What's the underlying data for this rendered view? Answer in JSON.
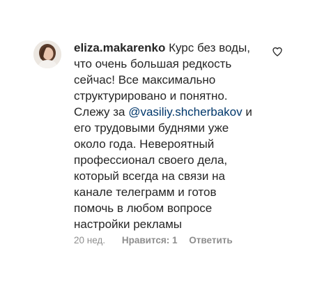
{
  "comment": {
    "avatar_icon": "user-avatar-photo",
    "username": "eliza.makarenko",
    "lines": [
      {
        "before": "Курс без воды,"
      },
      {
        "before": "что очень большая редкость"
      },
      {
        "before": "сейчас! Все максимально"
      },
      {
        "before": "структурировано и понятно."
      },
      {
        "before": "Слежу за ",
        "mention": "@vasiliy.shcherbakov",
        "after": " и"
      },
      {
        "before": "его трудовыми буднями уже"
      },
      {
        "before": "около года. Невероятный"
      },
      {
        "before": "профессионал своего дела,"
      },
      {
        "before": "который всегда на связи на"
      },
      {
        "before": "канале телеграмм и готов"
      },
      {
        "before": "помочь в любом вопросе"
      },
      {
        "before": "настройки рекламы"
      }
    ],
    "meta": {
      "time": "20 нед.",
      "likes": "Нравится: 1",
      "reply": "Ответить"
    },
    "like_icon": "heart-outline-icon",
    "colors": {
      "text": "#262626",
      "mention": "#00376b",
      "meta": "#8e8e8e"
    }
  }
}
